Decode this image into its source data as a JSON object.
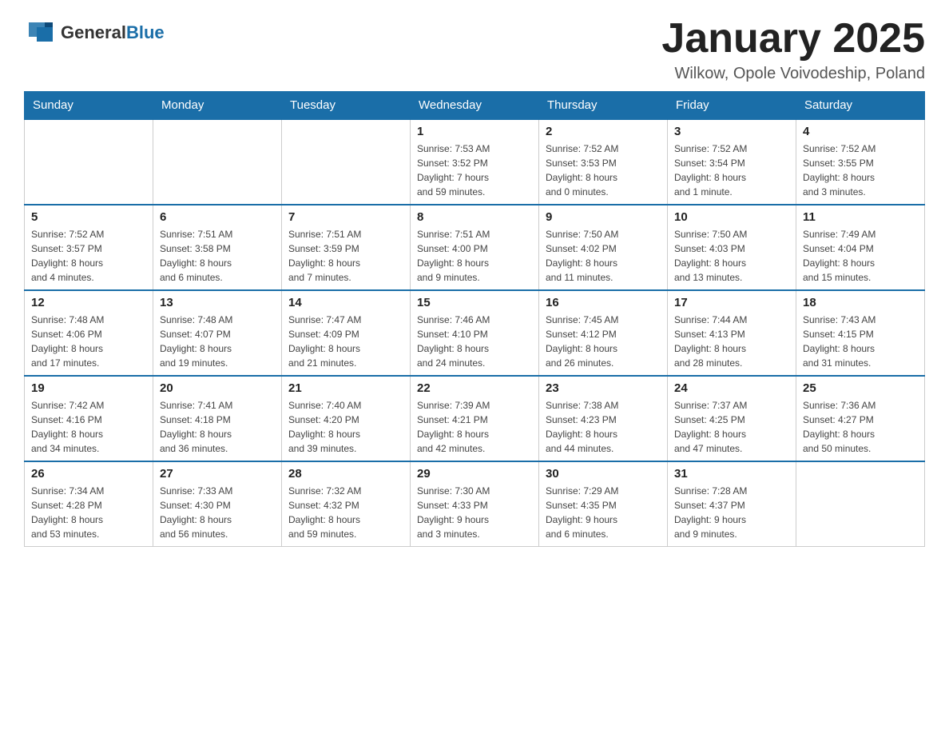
{
  "header": {
    "logo_general": "General",
    "logo_blue": "Blue",
    "month_title": "January 2025",
    "location": "Wilkow, Opole Voivodeship, Poland"
  },
  "days_of_week": [
    "Sunday",
    "Monday",
    "Tuesday",
    "Wednesday",
    "Thursday",
    "Friday",
    "Saturday"
  ],
  "weeks": [
    [
      {
        "day": "",
        "info": ""
      },
      {
        "day": "",
        "info": ""
      },
      {
        "day": "",
        "info": ""
      },
      {
        "day": "1",
        "info": "Sunrise: 7:53 AM\nSunset: 3:52 PM\nDaylight: 7 hours\nand 59 minutes."
      },
      {
        "day": "2",
        "info": "Sunrise: 7:52 AM\nSunset: 3:53 PM\nDaylight: 8 hours\nand 0 minutes."
      },
      {
        "day": "3",
        "info": "Sunrise: 7:52 AM\nSunset: 3:54 PM\nDaylight: 8 hours\nand 1 minute."
      },
      {
        "day": "4",
        "info": "Sunrise: 7:52 AM\nSunset: 3:55 PM\nDaylight: 8 hours\nand 3 minutes."
      }
    ],
    [
      {
        "day": "5",
        "info": "Sunrise: 7:52 AM\nSunset: 3:57 PM\nDaylight: 8 hours\nand 4 minutes."
      },
      {
        "day": "6",
        "info": "Sunrise: 7:51 AM\nSunset: 3:58 PM\nDaylight: 8 hours\nand 6 minutes."
      },
      {
        "day": "7",
        "info": "Sunrise: 7:51 AM\nSunset: 3:59 PM\nDaylight: 8 hours\nand 7 minutes."
      },
      {
        "day": "8",
        "info": "Sunrise: 7:51 AM\nSunset: 4:00 PM\nDaylight: 8 hours\nand 9 minutes."
      },
      {
        "day": "9",
        "info": "Sunrise: 7:50 AM\nSunset: 4:02 PM\nDaylight: 8 hours\nand 11 minutes."
      },
      {
        "day": "10",
        "info": "Sunrise: 7:50 AM\nSunset: 4:03 PM\nDaylight: 8 hours\nand 13 minutes."
      },
      {
        "day": "11",
        "info": "Sunrise: 7:49 AM\nSunset: 4:04 PM\nDaylight: 8 hours\nand 15 minutes."
      }
    ],
    [
      {
        "day": "12",
        "info": "Sunrise: 7:48 AM\nSunset: 4:06 PM\nDaylight: 8 hours\nand 17 minutes."
      },
      {
        "day": "13",
        "info": "Sunrise: 7:48 AM\nSunset: 4:07 PM\nDaylight: 8 hours\nand 19 minutes."
      },
      {
        "day": "14",
        "info": "Sunrise: 7:47 AM\nSunset: 4:09 PM\nDaylight: 8 hours\nand 21 minutes."
      },
      {
        "day": "15",
        "info": "Sunrise: 7:46 AM\nSunset: 4:10 PM\nDaylight: 8 hours\nand 24 minutes."
      },
      {
        "day": "16",
        "info": "Sunrise: 7:45 AM\nSunset: 4:12 PM\nDaylight: 8 hours\nand 26 minutes."
      },
      {
        "day": "17",
        "info": "Sunrise: 7:44 AM\nSunset: 4:13 PM\nDaylight: 8 hours\nand 28 minutes."
      },
      {
        "day": "18",
        "info": "Sunrise: 7:43 AM\nSunset: 4:15 PM\nDaylight: 8 hours\nand 31 minutes."
      }
    ],
    [
      {
        "day": "19",
        "info": "Sunrise: 7:42 AM\nSunset: 4:16 PM\nDaylight: 8 hours\nand 34 minutes."
      },
      {
        "day": "20",
        "info": "Sunrise: 7:41 AM\nSunset: 4:18 PM\nDaylight: 8 hours\nand 36 minutes."
      },
      {
        "day": "21",
        "info": "Sunrise: 7:40 AM\nSunset: 4:20 PM\nDaylight: 8 hours\nand 39 minutes."
      },
      {
        "day": "22",
        "info": "Sunrise: 7:39 AM\nSunset: 4:21 PM\nDaylight: 8 hours\nand 42 minutes."
      },
      {
        "day": "23",
        "info": "Sunrise: 7:38 AM\nSunset: 4:23 PM\nDaylight: 8 hours\nand 44 minutes."
      },
      {
        "day": "24",
        "info": "Sunrise: 7:37 AM\nSunset: 4:25 PM\nDaylight: 8 hours\nand 47 minutes."
      },
      {
        "day": "25",
        "info": "Sunrise: 7:36 AM\nSunset: 4:27 PM\nDaylight: 8 hours\nand 50 minutes."
      }
    ],
    [
      {
        "day": "26",
        "info": "Sunrise: 7:34 AM\nSunset: 4:28 PM\nDaylight: 8 hours\nand 53 minutes."
      },
      {
        "day": "27",
        "info": "Sunrise: 7:33 AM\nSunset: 4:30 PM\nDaylight: 8 hours\nand 56 minutes."
      },
      {
        "day": "28",
        "info": "Sunrise: 7:32 AM\nSunset: 4:32 PM\nDaylight: 8 hours\nand 59 minutes."
      },
      {
        "day": "29",
        "info": "Sunrise: 7:30 AM\nSunset: 4:33 PM\nDaylight: 9 hours\nand 3 minutes."
      },
      {
        "day": "30",
        "info": "Sunrise: 7:29 AM\nSunset: 4:35 PM\nDaylight: 9 hours\nand 6 minutes."
      },
      {
        "day": "31",
        "info": "Sunrise: 7:28 AM\nSunset: 4:37 PM\nDaylight: 9 hours\nand 9 minutes."
      },
      {
        "day": "",
        "info": ""
      }
    ]
  ]
}
